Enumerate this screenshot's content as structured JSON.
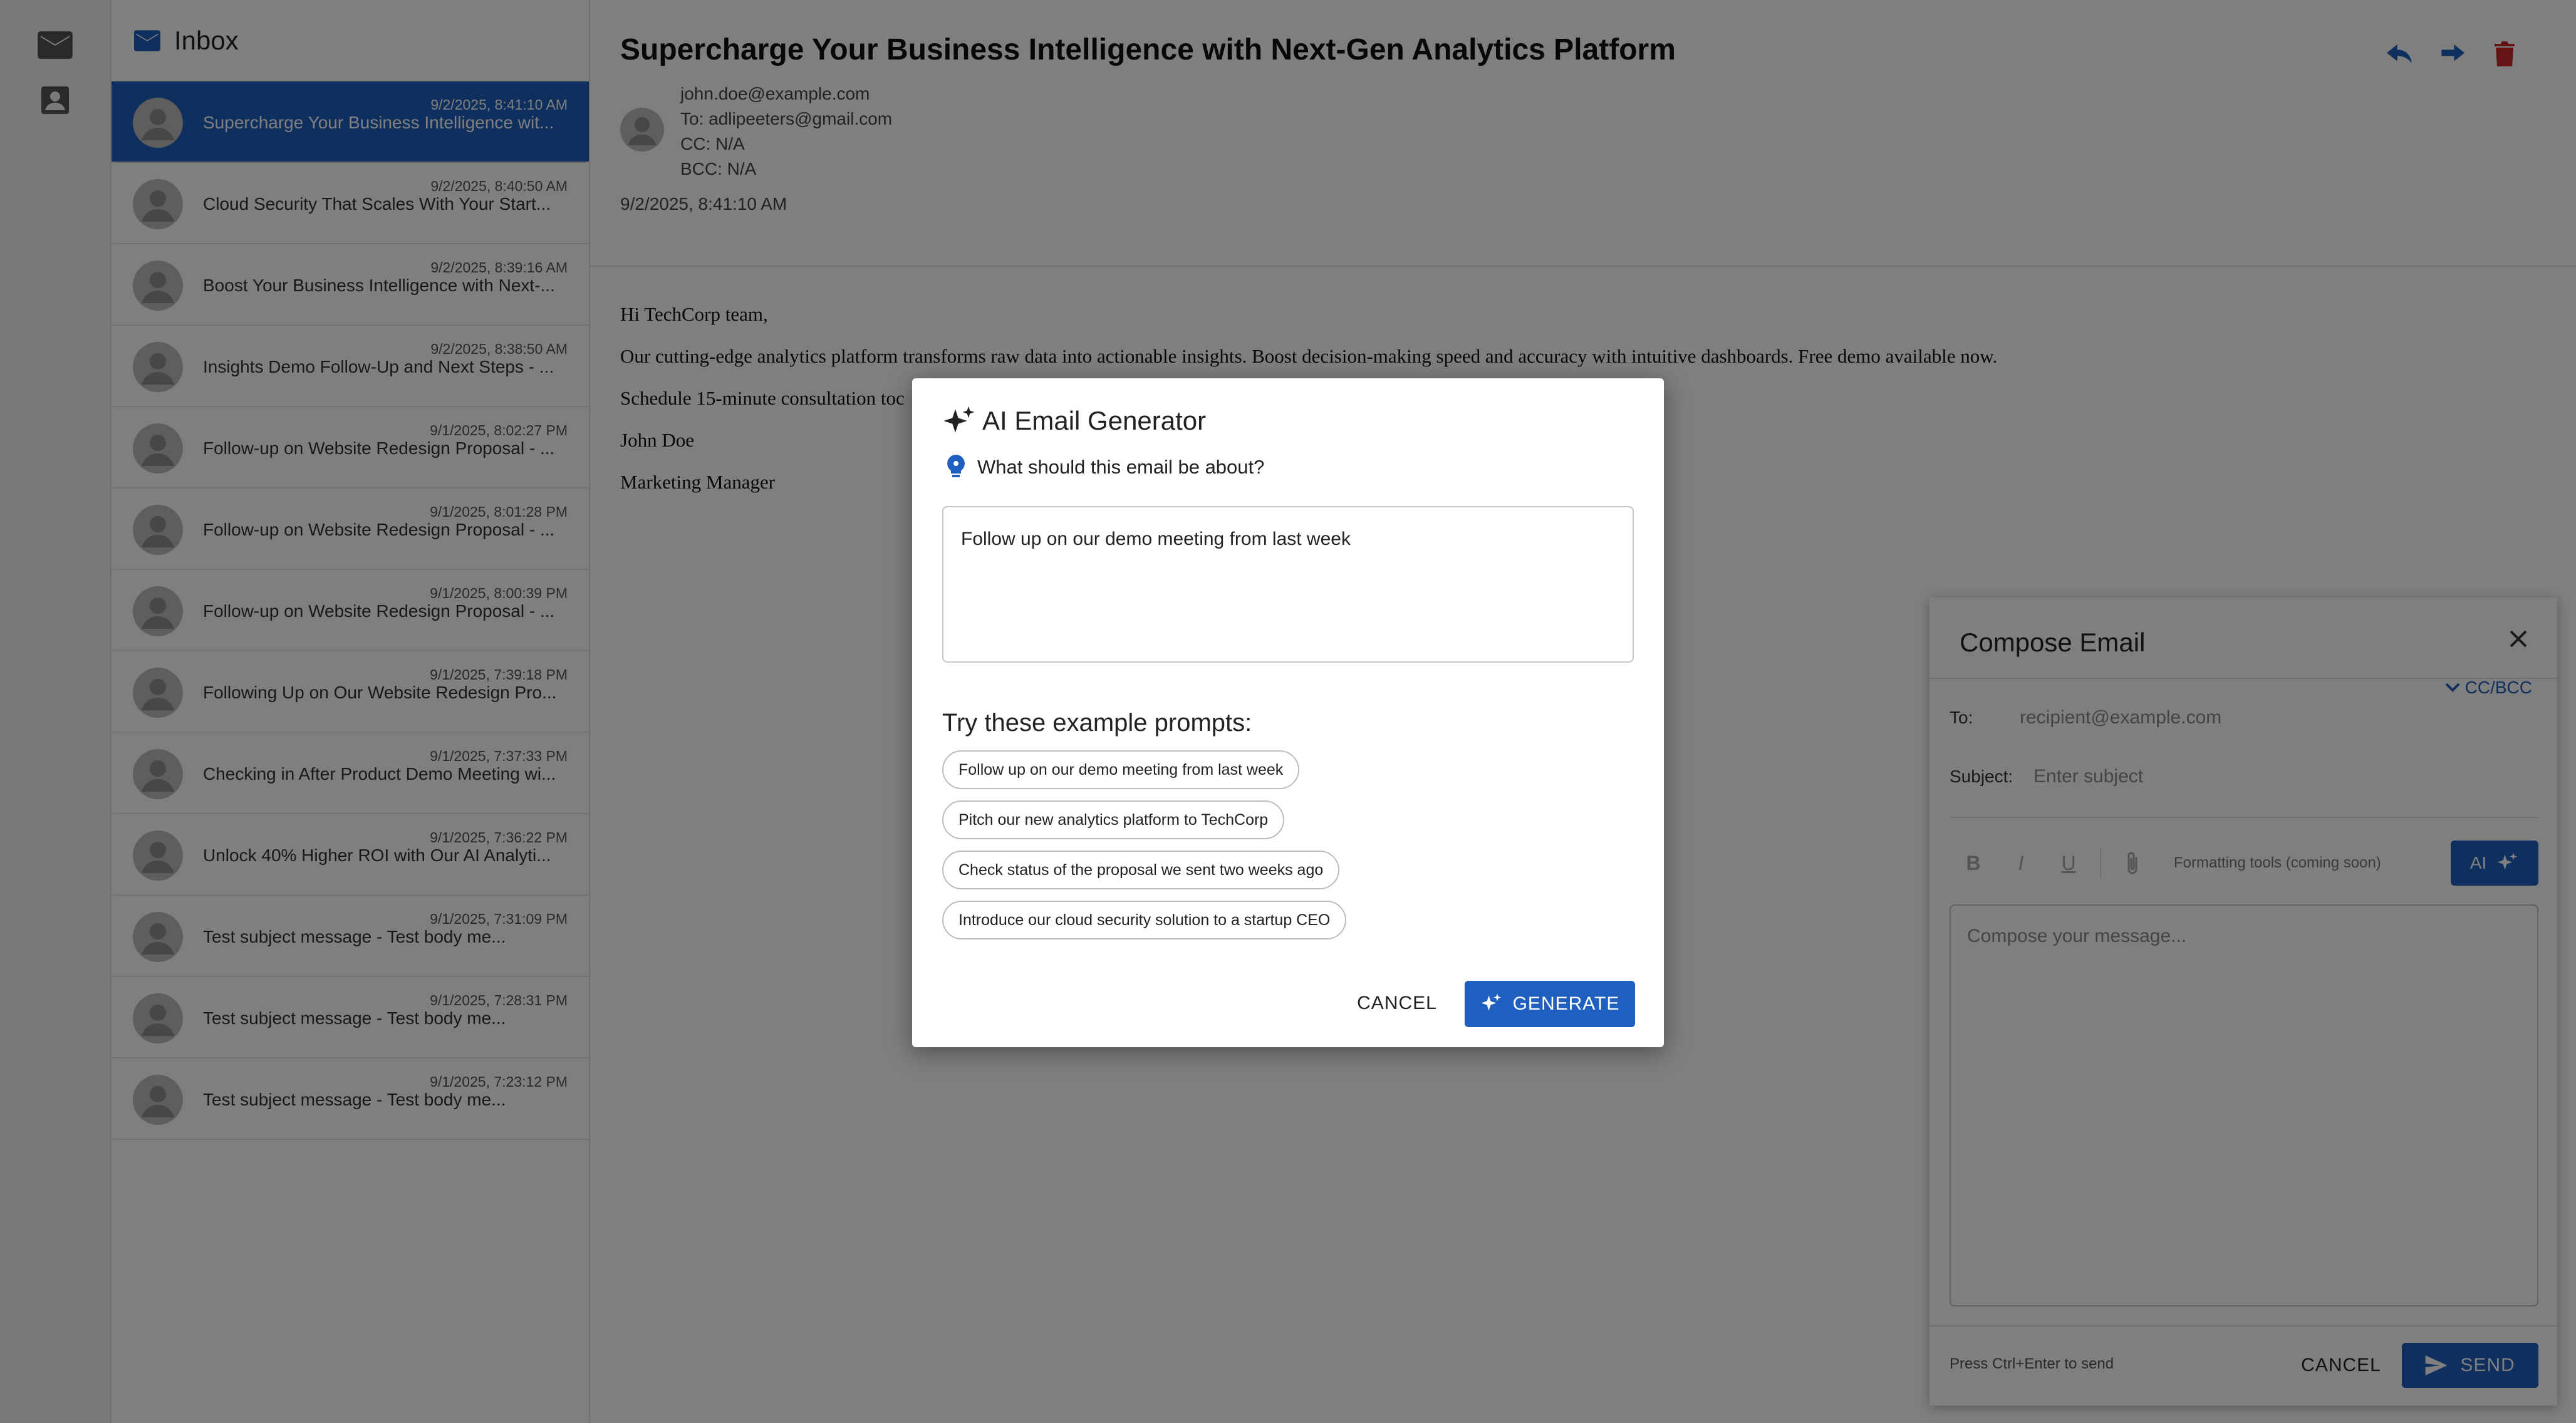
{
  "colors": {
    "accent": "#1f5fbf",
    "overlay": "rgba(0,0,0,0.5)"
  },
  "rail": {
    "items": [
      {
        "icon": "mail-icon"
      },
      {
        "icon": "contacts-icon"
      }
    ]
  },
  "inbox": {
    "title": "Inbox",
    "items": [
      {
        "date": "9/2/2025, 8:41:10 AM",
        "subject": "Supercharge Your Business Intelligence wit...",
        "selected": true
      },
      {
        "date": "9/2/2025, 8:40:50 AM",
        "subject": "Cloud Security That Scales With Your Start..."
      },
      {
        "date": "9/2/2025, 8:39:16 AM",
        "subject": "Boost Your Business Intelligence with Next-..."
      },
      {
        "date": "9/2/2025, 8:38:50 AM",
        "subject": "Insights Demo Follow-Up and Next Steps - ..."
      },
      {
        "date": "9/1/2025, 8:02:27 PM",
        "subject": "Follow-up on Website Redesign Proposal - ..."
      },
      {
        "date": "9/1/2025, 8:01:28 PM",
        "subject": "Follow-up on Website Redesign Proposal - ..."
      },
      {
        "date": "9/1/2025, 8:00:39 PM",
        "subject": "Follow-up on Website Redesign Proposal - ..."
      },
      {
        "date": "9/1/2025, 7:39:18 PM",
        "subject": "Following Up on Our Website Redesign Pro..."
      },
      {
        "date": "9/1/2025, 7:37:33 PM",
        "subject": "Checking in After Product Demo Meeting wi..."
      },
      {
        "date": "9/1/2025, 7:36:22 PM",
        "subject": "Unlock 40% Higher ROI with Our AI Analyti..."
      },
      {
        "date": "9/1/2025, 7:31:09 PM",
        "subject": "Test subject message - Test body me..."
      },
      {
        "date": "9/1/2025, 7:28:31 PM",
        "subject": "Test subject message - Test body me..."
      },
      {
        "date": "9/1/2025, 7:23:12 PM",
        "subject": "Test subject message - Test body me..."
      }
    ]
  },
  "reader": {
    "title": "Supercharge Your Business Intelligence with Next-Gen Analytics Platform",
    "from": "john.doe@example.com",
    "to": "To: adlipeeters@gmail.com",
    "cc": "CC: N/A",
    "bcc": "BCC: N/A",
    "date": "9/2/2025, 8:41:10 AM",
    "body": [
      "Hi TechCorp team,",
      "Our cutting-edge analytics platform transforms raw data into actionable insights. Boost decision-making speed and accuracy with intuitive dashboards. Free demo available now.",
      "Schedule 15-minute consultation toc",
      "John Doe",
      "Marketing Manager"
    ],
    "actions": [
      "reply-icon",
      "forward-icon",
      "delete-icon"
    ]
  },
  "compose": {
    "title": "Compose Email",
    "to_label": "To:",
    "to_placeholder": "recipient@example.com",
    "ccbcc_label": "CC/BCC",
    "subject_label": "Subject:",
    "subject_placeholder": "Enter subject",
    "formatting": {
      "bold": "B",
      "italic": "I",
      "underline": "U",
      "note": "Formatting tools (coming soon)"
    },
    "ai_label": "AI",
    "body_placeholder": "Compose your message...",
    "hint": "Press Ctrl+Enter to send",
    "cancel_label": "CANCEL",
    "send_label": "SEND"
  },
  "ai_dialog": {
    "title": "AI Email Generator",
    "question": "What should this email be about?",
    "prompt_value": "Follow up on our demo meeting from last week",
    "examples_heading": "Try these example prompts:",
    "examples": [
      "Follow up on our demo meeting from last week",
      "Pitch our new analytics platform to TechCorp",
      "Check status of the proposal we sent two weeks ago",
      "Introduce our cloud security solution to a startup CEO"
    ],
    "cancel_label": "CANCEL",
    "generate_label": "GENERATE"
  }
}
